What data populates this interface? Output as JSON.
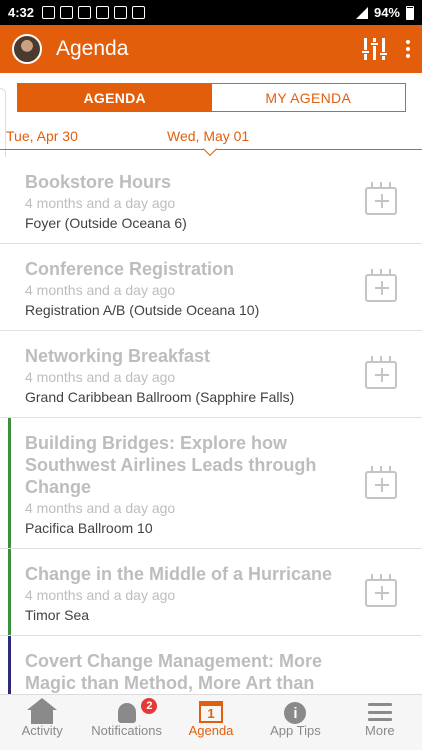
{
  "status_bar": {
    "time": "4:32",
    "battery": "94%"
  },
  "header": {
    "title": "Agenda"
  },
  "tabs": {
    "agenda": "AGENDA",
    "my_agenda": "MY AGENDA"
  },
  "dates": {
    "previous": "Tue, Apr 30",
    "current": "Wed, May 01"
  },
  "sessions": [
    {
      "title": "Bookstore Hours",
      "time": "4 months and a day ago",
      "location": "Foyer (Outside Oceana 6)"
    },
    {
      "title": "Conference Registration",
      "time": "4 months and a day ago",
      "location": "Registration A/B (Outside Oceana 10)"
    },
    {
      "title": "Networking Breakfast",
      "time": "4 months and a day ago",
      "location": "Grand Caribbean Ballroom (Sapphire Falls)"
    },
    {
      "title": "Building Bridges:  Explore how Southwest Airlines Leads through Change",
      "time": "4 months and a day ago",
      "location": "Pacifica Ballroom 10",
      "track_color": "#3a8f3a"
    },
    {
      "title": "Change in the Middle of a Hurricane",
      "time": "4 months and a day ago",
      "location": "Timor Sea",
      "track_color": "#3a8f3a"
    },
    {
      "title": "Covert Change Management:  More Magic than Method, More Art than",
      "track_color": "#2d2a7a"
    }
  ],
  "bottom_nav": {
    "activity": "Activity",
    "notifications": "Notifications",
    "notifications_badge": "2",
    "agenda": "Agenda",
    "agenda_icon_day": "1",
    "app_tips": "App Tips",
    "more": "More"
  },
  "colors": {
    "accent": "#E35E0B"
  }
}
